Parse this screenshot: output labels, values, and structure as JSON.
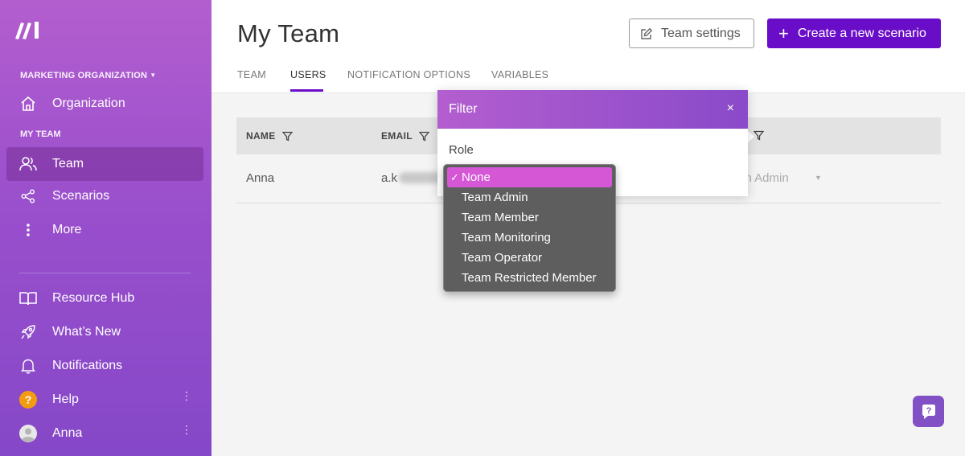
{
  "sidebar": {
    "org_label": "MARKETING ORGANIZATION",
    "section_label": "MY TEAM",
    "items": [
      {
        "label": "Organization",
        "icon": "home-icon"
      },
      {
        "label": "Team",
        "icon": "users-icon",
        "active": true
      },
      {
        "label": "Scenarios",
        "icon": "share-icon"
      },
      {
        "label": "More",
        "icon": "more-vertical-icon"
      },
      {
        "label": "Resource Hub",
        "icon": "book-icon"
      },
      {
        "label": "What’s New",
        "icon": "rocket-icon"
      },
      {
        "label": "Notifications",
        "icon": "bell-icon"
      },
      {
        "label": "Help",
        "icon": "help-circle-icon"
      },
      {
        "label": "Anna",
        "icon": "avatar-icon"
      }
    ]
  },
  "header": {
    "title": "My Team",
    "settings_label": "Team settings",
    "create_label": "Create a new scenario"
  },
  "tabs": [
    {
      "label": "TEAM"
    },
    {
      "label": "USERS",
      "active": true
    },
    {
      "label": "NOTIFICATION OPTIONS"
    },
    {
      "label": "VARIABLES"
    }
  ],
  "table": {
    "columns": [
      "NAME",
      "EMAIL"
    ],
    "rows": [
      {
        "name": "Anna",
        "email": "a.k",
        "role": "am Admin"
      }
    ]
  },
  "filter": {
    "title": "Filter",
    "close": "×",
    "label": "Role"
  },
  "dropdown": {
    "options": [
      "None",
      "Team Admin",
      "Team Member",
      "Team Monitoring",
      "Team Operator",
      "Team Restricted Member"
    ],
    "selected_index": 0,
    "check": "✓"
  },
  "colors": {
    "accent": "#6a0dc8",
    "sidebar_top": "#b35ecf",
    "sidebar_bottom": "#8548c8",
    "selected_option": "#d557d6",
    "help_badge": "#f39c12"
  }
}
